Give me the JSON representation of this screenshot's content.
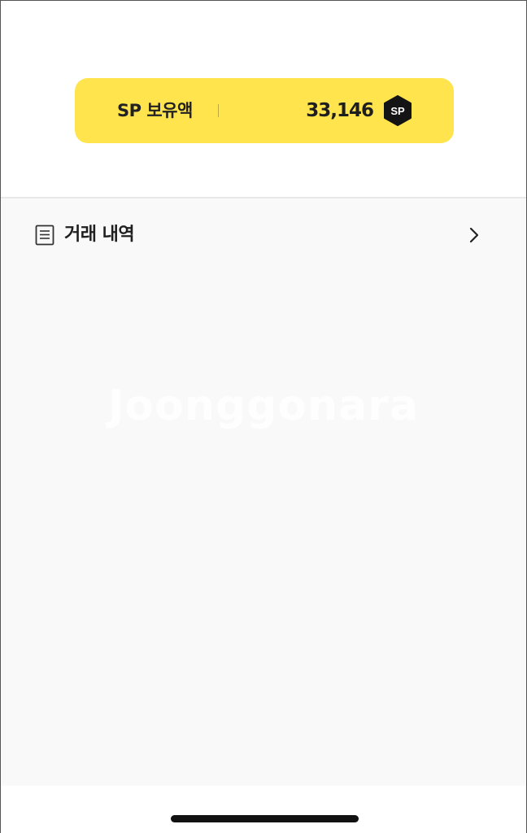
{
  "sp_card": {
    "label": "SP 보유액",
    "amount": "33,146",
    "badge_text": "SP",
    "background_color": "#ffe44d"
  },
  "history": {
    "icon": "document-list-icon",
    "label": "거래 내역",
    "chevron_icon": "chevron-right-icon"
  },
  "watermark": {
    "text": "Joonggonara"
  }
}
